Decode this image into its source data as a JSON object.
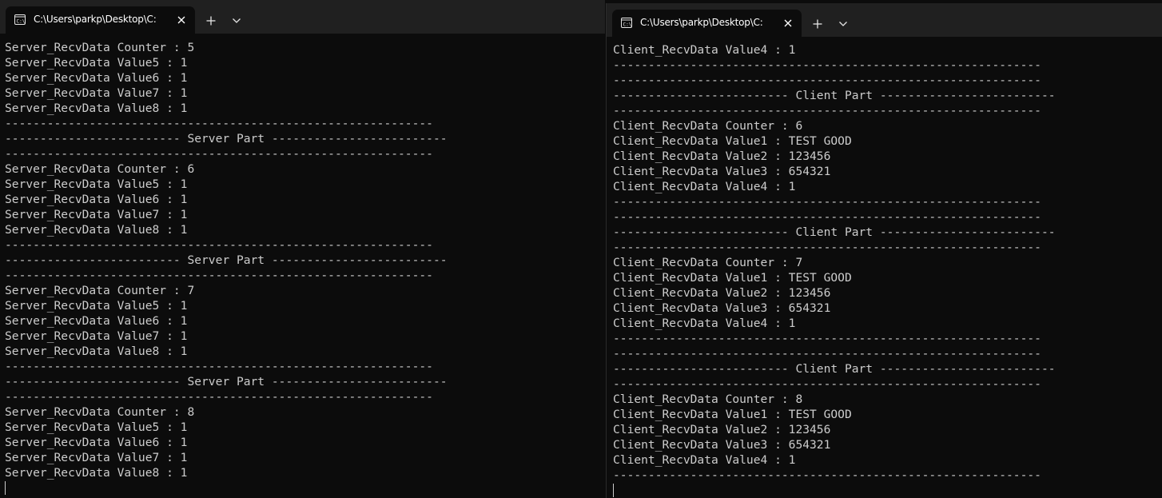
{
  "left_window": {
    "tab_title": "C:\\Users\\parkp\\Desktop\\C:",
    "lines": [
      "Server_RecvData Counter : 5",
      "Server_RecvData Value5 : 1",
      "Server_RecvData Value6 : 1",
      "Server_RecvData Value7 : 1",
      "Server_RecvData Value8 : 1",
      "-------------------------------------------------------------",
      "------------------------- Server Part -------------------------",
      "-------------------------------------------------------------",
      "Server_RecvData Counter : 6",
      "Server_RecvData Value5 : 1",
      "Server_RecvData Value6 : 1",
      "Server_RecvData Value7 : 1",
      "Server_RecvData Value8 : 1",
      "-------------------------------------------------------------",
      "------------------------- Server Part -------------------------",
      "-------------------------------------------------------------",
      "Server_RecvData Counter : 7",
      "Server_RecvData Value5 : 1",
      "Server_RecvData Value6 : 1",
      "Server_RecvData Value7 : 1",
      "Server_RecvData Value8 : 1",
      "-------------------------------------------------------------",
      "------------------------- Server Part -------------------------",
      "-------------------------------------------------------------",
      "Server_RecvData Counter : 8",
      "Server_RecvData Value5 : 1",
      "Server_RecvData Value6 : 1",
      "Server_RecvData Value7 : 1",
      "Server_RecvData Value8 : 1"
    ]
  },
  "right_window": {
    "tab_title": "C:\\Users\\parkp\\Desktop\\C:",
    "lines": [
      "Client_RecvData Value4 : 1",
      "-------------------------------------------------------------",
      "-------------------------------------------------------------",
      "------------------------- Client Part -------------------------",
      "-------------------------------------------------------------",
      "Client_RecvData Counter : 6",
      "Client_RecvData Value1 : TEST GOOD",
      "Client_RecvData Value2 : 123456",
      "Client_RecvData Value3 : 654321",
      "Client_RecvData Value4 : 1",
      "-------------------------------------------------------------",
      "-------------------------------------------------------------",
      "------------------------- Client Part -------------------------",
      "-------------------------------------------------------------",
      "Client_RecvData Counter : 7",
      "Client_RecvData Value1 : TEST GOOD",
      "Client_RecvData Value2 : 123456",
      "Client_RecvData Value3 : 654321",
      "Client_RecvData Value4 : 1",
      "-------------------------------------------------------------",
      "-------------------------------------------------------------",
      "------------------------- Client Part -------------------------",
      "-------------------------------------------------------------",
      "Client_RecvData Counter : 8",
      "Client_RecvData Value1 : TEST GOOD",
      "Client_RecvData Value2 : 123456",
      "Client_RecvData Value3 : 654321",
      "Client_RecvData Value4 : 1",
      "-------------------------------------------------------------"
    ]
  },
  "icons": {
    "tab_icon": "terminal-icon",
    "close": "close-icon",
    "new_tab": "plus-icon",
    "dropdown": "chevron-down-icon"
  },
  "colors": {
    "background": "#0c0c0c",
    "tabbar": "#202020",
    "text": "#cccccc"
  }
}
